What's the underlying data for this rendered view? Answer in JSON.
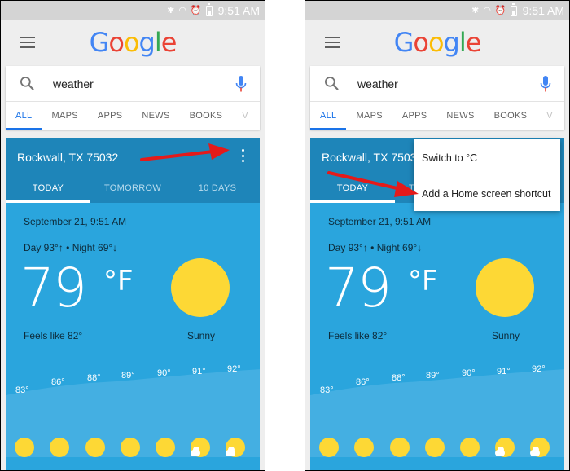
{
  "colors": {
    "statusbar": "#d4d4d4",
    "accent_blue": "#1a73e8",
    "card_header": "#1e85b9",
    "card_body": "#2aa5dd",
    "sun": "#fdd835",
    "arrow": "#e41a1a"
  },
  "status": {
    "time": "9:51 AM",
    "icons": [
      "bluetooth-icon",
      "wifi-icon",
      "alarm-icon",
      "battery-icon"
    ]
  },
  "logo": {
    "letters": [
      "G",
      "o",
      "o",
      "g",
      "l",
      "e"
    ],
    "colors": [
      "#4285f4",
      "#ea4335",
      "#fbbc05",
      "#4285f4",
      "#34a853",
      "#ea4335"
    ]
  },
  "search": {
    "query": "weather"
  },
  "tabs": [
    {
      "label": "ALL"
    },
    {
      "label": "MAPS"
    },
    {
      "label": "APPS"
    },
    {
      "label": "NEWS"
    },
    {
      "label": "BOOKS"
    },
    {
      "label": "V"
    }
  ],
  "weather": {
    "location": "Rockwall, TX 75032",
    "day_tabs": [
      "TODAY",
      "TOMORROW",
      "10 DAYS"
    ],
    "datetime": "September 21, 9:51 AM",
    "hilo": "Day 93°↑ • Night 69°↓",
    "temperature": "79",
    "unit": "°F",
    "feels_like": "Feels like 82°",
    "condition": "Sunny",
    "hourly_temps": [
      "83°",
      "86°",
      "88°",
      "89°",
      "90°",
      "91°",
      "92°"
    ],
    "hourly_icons": [
      "sun-icon",
      "sun-icon",
      "sun-icon",
      "sun-icon",
      "sun-icon",
      "partly-cloudy-icon",
      "partly-cloudy-icon"
    ]
  },
  "menu": {
    "items": [
      "Switch to °C",
      "Add a Home screen shortcut"
    ]
  }
}
